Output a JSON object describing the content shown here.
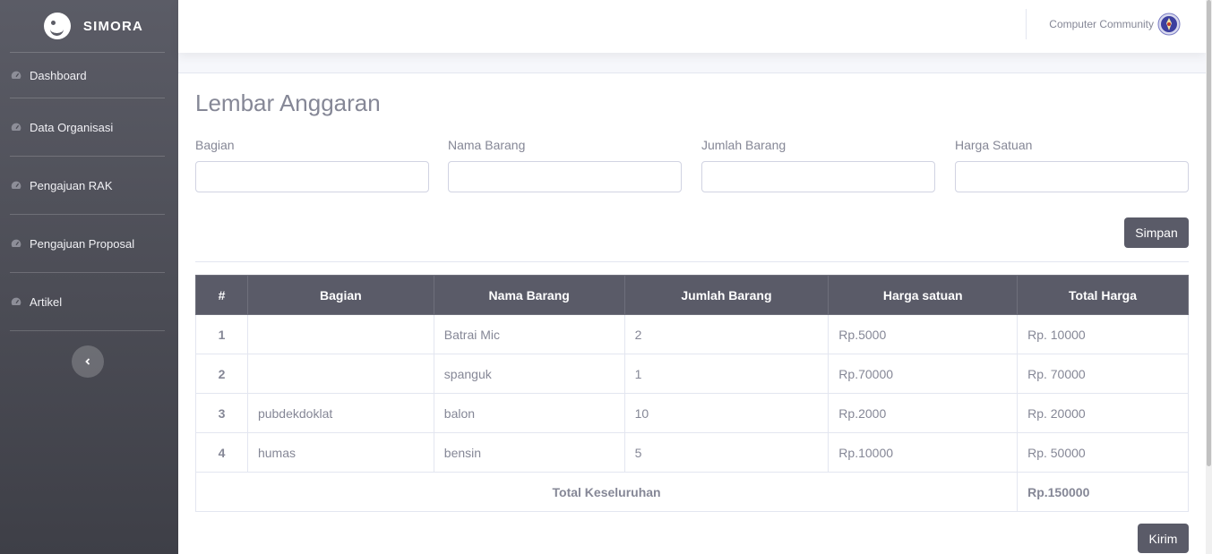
{
  "brand": {
    "name": "SIMORA"
  },
  "sidebar": {
    "items": [
      {
        "label": "Dashboard",
        "icon": "gauge-icon"
      },
      {
        "label": "Data Organisasi",
        "icon": "gauge-icon"
      },
      {
        "label": "Pengajuan RAK",
        "icon": "gauge-icon"
      },
      {
        "label": "Pengajuan Proposal",
        "icon": "gauge-icon"
      },
      {
        "label": "Artikel",
        "icon": "gauge-icon"
      }
    ],
    "toggle_icon": "chevron-left-icon"
  },
  "topbar": {
    "user_name": "Computer Community",
    "avatar_icon": "emblem-icon"
  },
  "main": {
    "title": "Lembar Anggaran",
    "form": {
      "fields": [
        {
          "label": "Bagian",
          "value": "",
          "placeholder": ""
        },
        {
          "label": "Nama Barang",
          "value": "",
          "placeholder": ""
        },
        {
          "label": "Jumlah Barang",
          "value": "",
          "placeholder": ""
        },
        {
          "label": "Harga Satuan",
          "value": "",
          "placeholder": ""
        }
      ],
      "save_label": "Simpan"
    },
    "table": {
      "headers": [
        "#",
        "Bagian",
        "Nama Barang",
        "Jumlah Barang",
        "Harga satuan",
        "Total Harga"
      ],
      "rows": [
        [
          "1",
          "",
          "Batrai Mic",
          "2",
          "Rp.5000",
          "Rp. 10000"
        ],
        [
          "2",
          "",
          "spanguk",
          "1",
          "Rp.70000",
          "Rp. 70000"
        ],
        [
          "3",
          "pubdekdoklat",
          "balon",
          "10",
          "Rp.2000",
          "Rp. 20000"
        ],
        [
          "4",
          "humas",
          "bensin",
          "5",
          "Rp.10000",
          "Rp. 50000"
        ]
      ],
      "total_label": "Total Keseluruhan",
      "total_value": "Rp.150000"
    },
    "send_label": "Kirim"
  },
  "colors": {
    "sidebar": "#5b5c66",
    "button": "#5a5b68",
    "text_muted": "#858796"
  }
}
